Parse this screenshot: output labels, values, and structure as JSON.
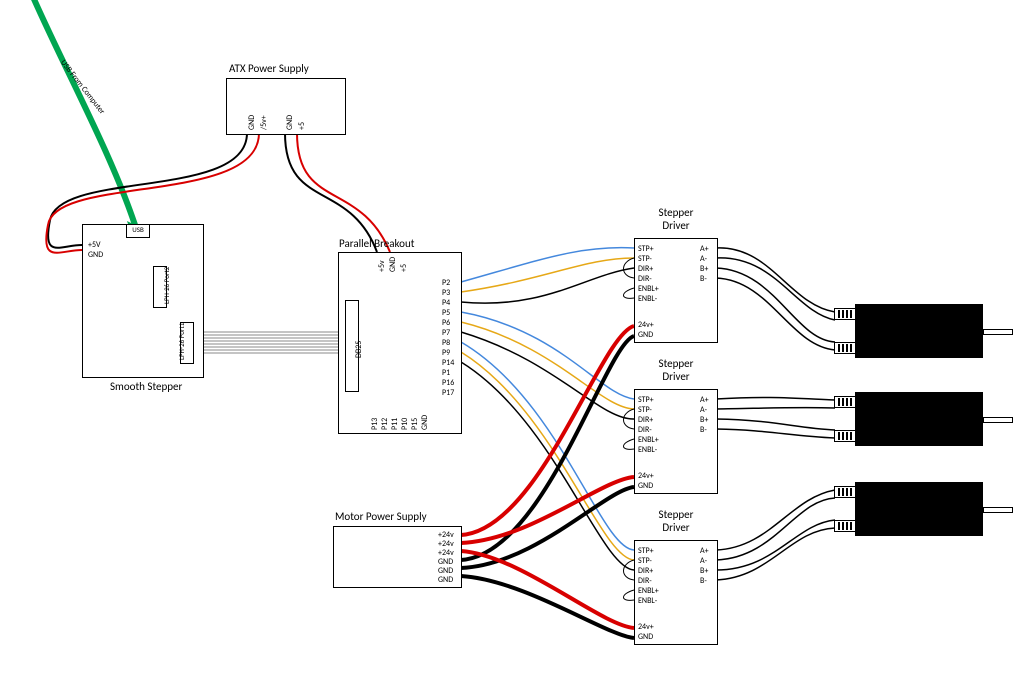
{
  "usb_cable_label": "USB From Computer",
  "smooth_stepper": {
    "title": "Smooth Stepper",
    "usb_port": "USB",
    "p5v": "+5V",
    "gnd": "GND",
    "port1": "LPH-26\nPort1",
    "port2": "LPH-26\nPort2"
  },
  "atx": {
    "title": "ATX Power Supply",
    "pins": [
      "GND",
      "/5v+",
      "GND",
      "+5"
    ]
  },
  "breakout": {
    "title": "Parallel Breakout",
    "db25": "DB25",
    "top_pins": [
      "+5v",
      "GND",
      "+5"
    ],
    "right_pins": [
      "P2",
      "P3",
      "P4",
      "P5",
      "P6",
      "P7",
      "P8",
      "P9",
      "P14",
      "P1",
      "P16",
      "P17"
    ],
    "bottom_pins": [
      "P13",
      "P12",
      "P11",
      "P10",
      "P15",
      "GND"
    ]
  },
  "motor_psu": {
    "title": "Motor Power Supply",
    "pins": [
      "+24v",
      "+24v",
      "+24v",
      "GND",
      "GND",
      "GND"
    ]
  },
  "driver": {
    "title": "Stepper Driver",
    "left_pins": [
      "STP+",
      "STP-",
      "DIR+",
      "DIR-",
      "ENBL+",
      "ENBL-"
    ],
    "pwr_pins": [
      "24v+",
      "GND"
    ],
    "right_pins": [
      "A+",
      "A-",
      "B+",
      "B-"
    ]
  }
}
